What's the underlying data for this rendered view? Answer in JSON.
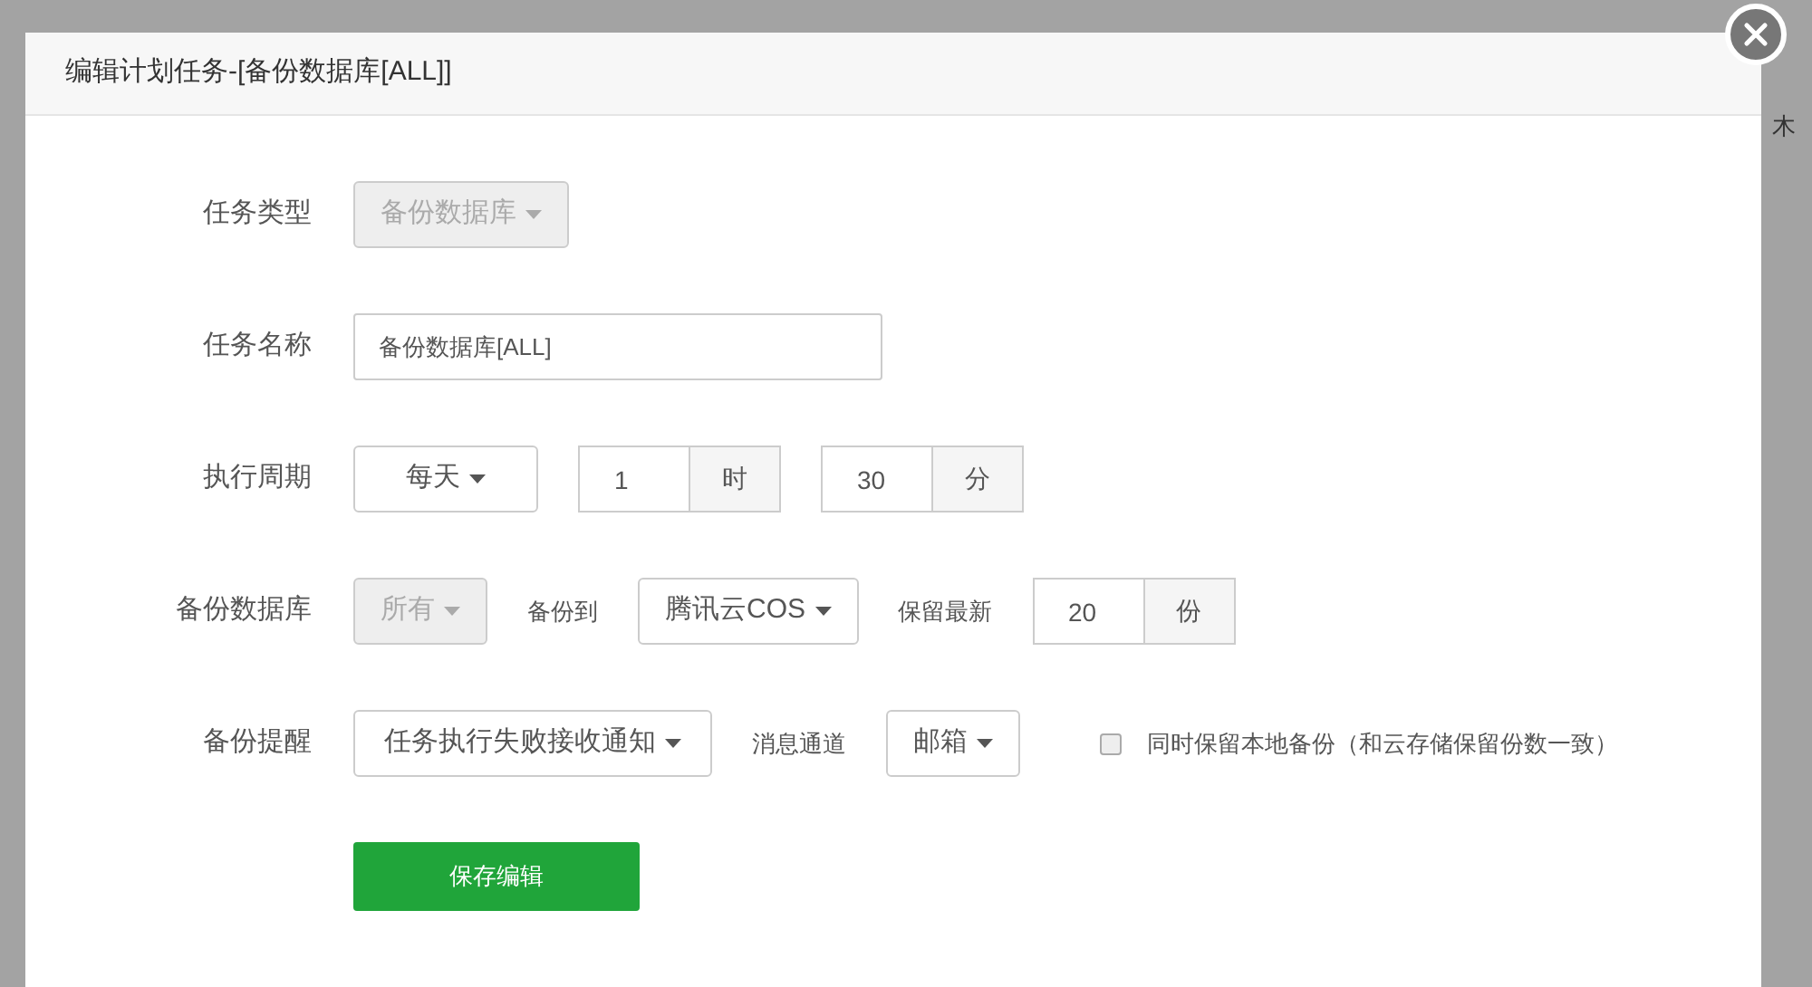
{
  "background": {
    "text": "木"
  },
  "dialog": {
    "title": "编辑计划任务-[备份数据库[ALL]]",
    "rows": [
      {
        "label": "任务类型",
        "controls": [
          {
            "kind": "select",
            "value": "备份数据库",
            "disabled": true
          }
        ]
      },
      {
        "label": "任务名称",
        "controls": [
          {
            "kind": "input",
            "value": "备份数据库[ALL]"
          }
        ]
      },
      {
        "label": "执行周期",
        "controls": [
          {
            "kind": "select",
            "value": "每天",
            "disabled": false
          },
          {
            "kind": "addon_input",
            "value": "1",
            "addon": "时"
          },
          {
            "kind": "addon_input",
            "value": "30",
            "addon": "分"
          }
        ]
      },
      {
        "label": "备份数据库",
        "controls": [
          {
            "kind": "select",
            "value": "所有",
            "disabled": true
          },
          {
            "kind": "text",
            "value": "备份到"
          },
          {
            "kind": "select",
            "value": "腾讯云COS",
            "disabled": false
          },
          {
            "kind": "text",
            "value": "保留最新"
          },
          {
            "kind": "addon_input",
            "value": "20",
            "addon": "份"
          }
        ]
      },
      {
        "label": "备份提醒",
        "controls": [
          {
            "kind": "select",
            "value": "任务执行失败接收通知",
            "disabled": false
          },
          {
            "kind": "text",
            "value": "消息通道"
          },
          {
            "kind": "select",
            "value": "邮箱",
            "disabled": false
          },
          {
            "kind": "checkbox",
            "label": "同时保留本地备份（和云存储保留份数一致）",
            "checked": false
          }
        ]
      }
    ],
    "save_button": "保存编辑"
  }
}
